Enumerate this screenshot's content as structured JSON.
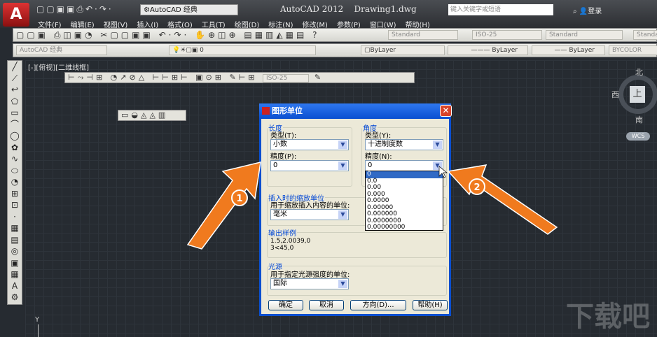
{
  "titlebar": {
    "app_title": "AutoCAD 2012",
    "doc_title": "Drawing1.dwg",
    "workspace": "AutoCAD 经典",
    "search_placeholder": "键入关键字或短语",
    "login": "登录"
  },
  "menu": [
    "文件(F)",
    "编辑(E)",
    "视图(V)",
    "插入(I)",
    "格式(O)",
    "工具(T)",
    "绘图(D)",
    "标注(N)",
    "修改(M)",
    "参数(P)",
    "窗口(W)",
    "帮助(H)"
  ],
  "toolbar1": {
    "text_style": "Standard",
    "dim_style": "ISO-25",
    "table_style": "Standard",
    "mleader_style": "Standard"
  },
  "toolbar2": {
    "workspace": "AutoCAD 经典",
    "layer": "0",
    "color": "ByLayer",
    "linetype": "ByLayer",
    "lineweight": "ByLayer",
    "plotstyle": "BYCOLOR"
  },
  "viewport": {
    "label": "[-][俯视][二维线框]",
    "dim_style": "ISO-25",
    "y_axis": "Y"
  },
  "viewcube": {
    "north": "北",
    "west": "西",
    "south": "南",
    "top": "上",
    "wcs": "WCS"
  },
  "dialog": {
    "title": "图形单位",
    "length": {
      "legend": "长度",
      "type_label": "类型(T):",
      "type_value": "小数",
      "precision_label": "精度(P):",
      "precision_value": "0"
    },
    "angle": {
      "legend": "角度",
      "type_label": "类型(Y):",
      "type_value": "十进制度数",
      "precision_label": "精度(N):",
      "precision_value": "0",
      "options": [
        "0",
        "0.0",
        "0.00",
        "0.000",
        "0.0000",
        "0.00000",
        "0.000000",
        "0.0000000",
        "0.00000000"
      ],
      "selected": "0"
    },
    "insert": {
      "legend": "插入时的缩放单位",
      "label": "用于缩放插入内容的单位:",
      "value": "毫米"
    },
    "sample": {
      "legend": "输出样例",
      "line1": "1.5,2.0039,0",
      "line2": "3<45,0"
    },
    "lighting": {
      "legend": "光源",
      "label": "用于指定光源强度的单位:",
      "value": "国际"
    },
    "buttons": {
      "ok": "确定",
      "cancel": "取消",
      "direction": "方向(D)...",
      "help": "帮助(H)"
    }
  },
  "annotations": {
    "arrow1": "1",
    "arrow2": "2",
    "arrow_color": "#f07a1e"
  },
  "watermark": "下载吧"
}
